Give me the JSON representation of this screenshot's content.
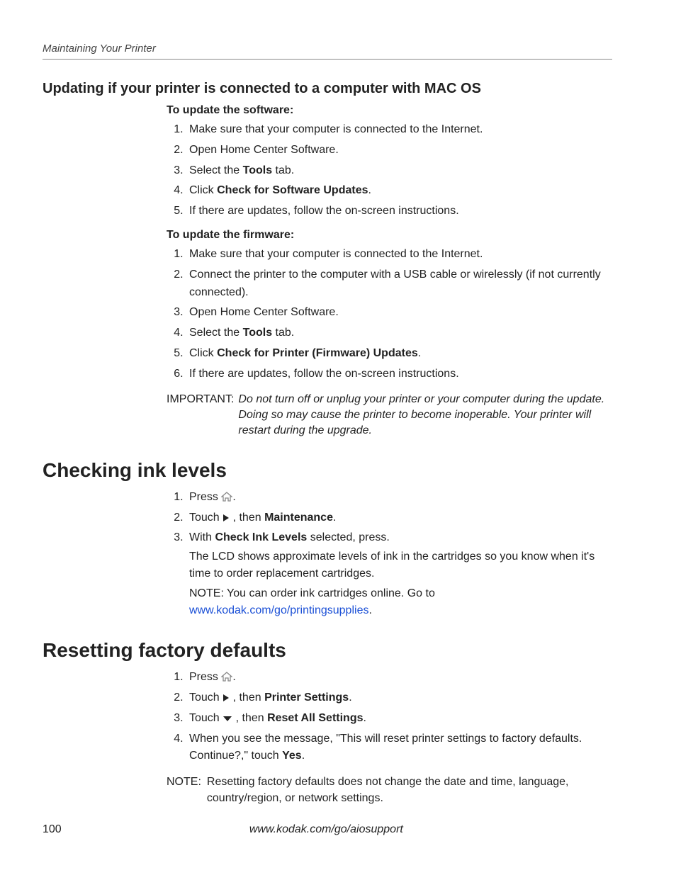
{
  "runningHead": "Maintaining Your Printer",
  "sec1": {
    "title": "Updating if your printer is connected to a computer with MAC OS",
    "sw": {
      "lead": "To update the software",
      "items": {
        "i1": "Make sure that your computer is connected to the Internet.",
        "i2": "Open Home Center Software.",
        "i3a": "Select the ",
        "i3b": "Tools",
        "i3c": " tab.",
        "i4a": "Click ",
        "i4b": "Check for Software Updates",
        "i4c": ".",
        "i5": "If there are updates, follow the on-screen instructions."
      }
    },
    "fw": {
      "lead": "To update the firmware",
      "items": {
        "i1": "Make sure that your computer is connected to the Internet.",
        "i2": "Connect the printer to the computer with a USB cable or wirelessly (if not currently connected).",
        "i3": "Open Home Center Software.",
        "i4a": "Select the ",
        "i4b": "Tools",
        "i4c": " tab.",
        "i5a": "Click ",
        "i5b": "Check for Printer (Firmware) Updates",
        "i5c": ".",
        "i6": "If there are updates, follow the on-screen instructions."
      }
    },
    "importantLabel": "IMPORTANT:",
    "importantBody": "Do not turn off or unplug your printer or your computer during the update. Doing so may cause the printer to become inoperable. Your printer will restart during the upgrade."
  },
  "sec2": {
    "title": "Checking ink levels",
    "items": {
      "i1a": "Press ",
      "i1b": ".",
      "i2a": "Touch ",
      "i2b": " , then ",
      "i2c": "Maintenance",
      "i2d": ".",
      "i3a": "With ",
      "i3b": "Check Ink Levels",
      "i3c": " selected, press.",
      "i3body": "The LCD shows approximate levels of ink in the cartridges so you know when it's time to order replacement cartridges.",
      "noteLead": "NOTE: You can order ink cartridges online. Go to ",
      "link": "www.kodak.com/go/printingsupplies",
      "noteTail": "."
    }
  },
  "sec3": {
    "title": "Resetting factory defaults",
    "items": {
      "i1a": "Press ",
      "i1b": ".",
      "i2a": "Touch ",
      "i2b": " , then ",
      "i2c": "Printer Settings",
      "i2d": ".",
      "i3a": "Touch ",
      "i3b": " , then ",
      "i3c": "Reset All Settings",
      "i3d": ".",
      "i4a": "When you see the message, \"This will reset printer settings to factory defaults. Continue?,\" touch ",
      "i4b": "Yes",
      "i4c": "."
    },
    "noteLabel": "NOTE:",
    "noteBody": "Resetting factory defaults does not change the date and time, language, country/region, or network settings."
  },
  "footer": {
    "page": "100",
    "url": "www.kodak.com/go/aiosupport"
  }
}
